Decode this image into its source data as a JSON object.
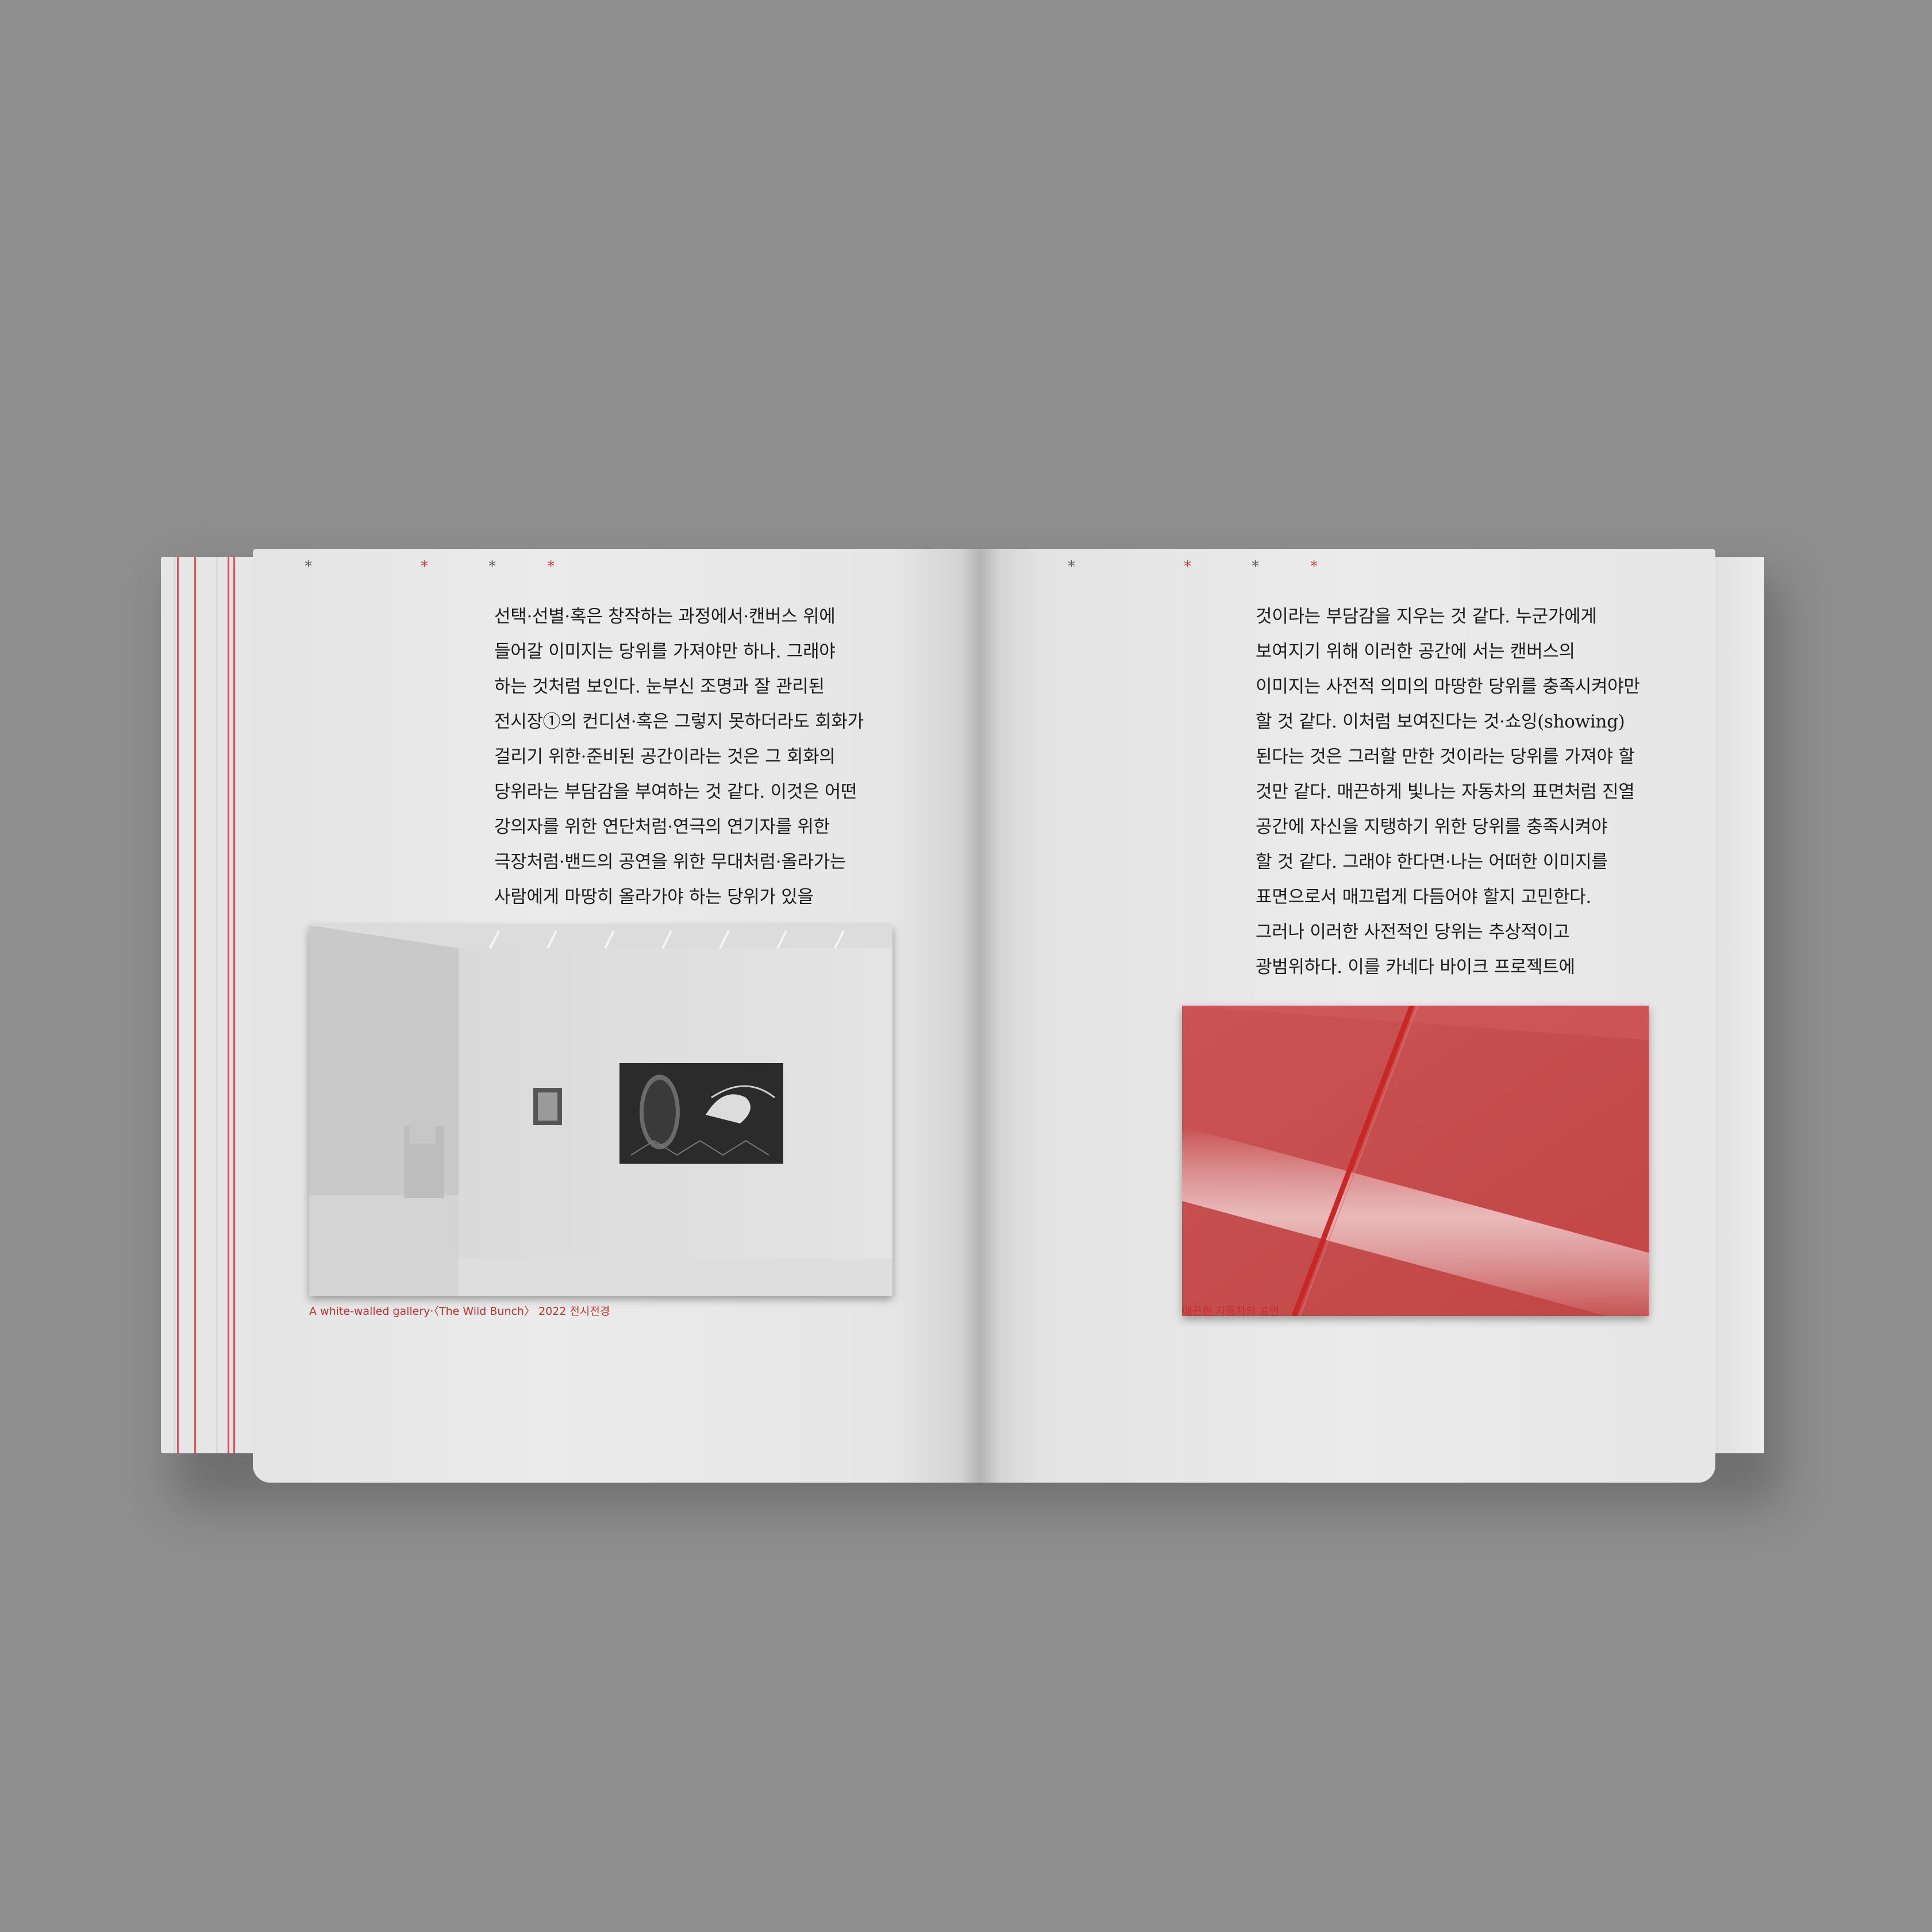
{
  "left_page": {
    "marks": [
      "*",
      "*",
      "*",
      "*"
    ],
    "text_lines": [
      "선택·선별·혹은 창작하는 과정에서·캔버스 위에",
      "들어갈 이미지는 당위를 가져야만 하나. 그래야",
      "하는 것처럼 보인다. 눈부신 조명과 잘 관리된",
      "전시장①의 컨디션·혹은 그렇지 못하더라도 회화가",
      "걸리기 위한·준비된 공간이라는 것은 그 회화의",
      "당위라는 부담감을 부여하는 것 같다. 이것은 어떤",
      "강의자를 위한 연단처럼·연극의 연기자를 위한",
      "극장처럼·밴드의 공연을 위한 무대처럼·올라가는",
      "사람에게 마땅히 올라가야 하는 당위가 있을"
    ],
    "caption": "A white-walled gallery·〈The Wild Bunch〉 2022 전시전경"
  },
  "right_page": {
    "marks": [
      "*",
      "*",
      "*",
      "*"
    ],
    "text_lines": [
      "것이라는 부담감을 지우는 것 같다. 누군가에게",
      "보여지기 위해 이러한 공간에 서는 캔버스의",
      "이미지는 사전적 의미의 마땅한 당위를 충족시켜야만",
      "할 것 같다. 이처럼 보여진다는 것·쇼잉(showing)",
      "된다는 것은 그러할 만한 것이라는 당위를 가져야 할",
      "것만 같다. 매끈하게 빛나는 자동차의 표면처럼 진열",
      "공간에 자신을 지탱하기 위한 당위를 충족시켜야",
      "할 것 같다. 그래야 한다면·나는 어떠한 이미지를",
      "표면으로서 매끄럽게 다듬어야 할지 고민한다.",
      "그러나 이러한 사전적인 당위는 추상적이고",
      "광범위하다. 이를 카네다 바이크 프로젝트에"
    ],
    "caption": "매끈한 자동차의 표면"
  },
  "colors": {
    "background": "#8e8e8e",
    "paper": "#ebebeb",
    "accent_red": "#d4312e",
    "text": "#1c1c1c"
  }
}
